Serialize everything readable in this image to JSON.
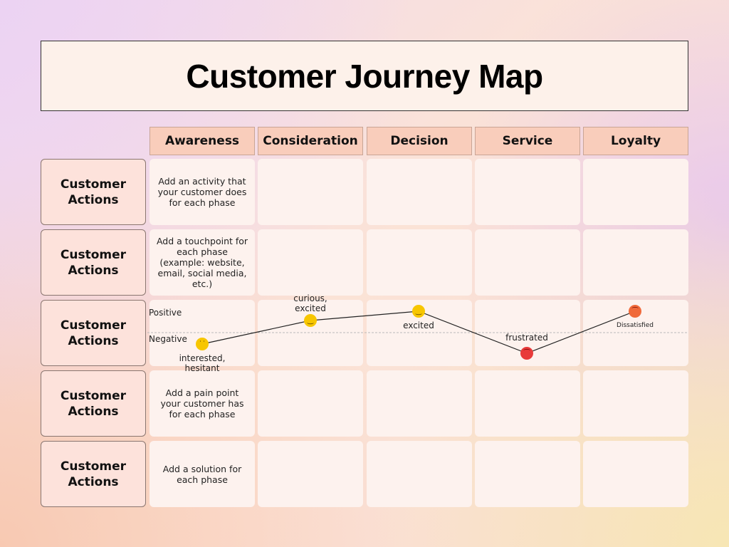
{
  "title": "Customer Journey Map",
  "phases": [
    "Awareness",
    "Consideration",
    "Decision",
    "Service",
    "Loyalty"
  ],
  "rows": [
    {
      "label": "Customer Actions",
      "awareness_text": "Add an activity that your customer does for each phase"
    },
    {
      "label": "Customer Actions",
      "awareness_text": "Add a touchpoint for each phase (example: website, email, social media, etc.)"
    },
    {
      "label": "Customer Actions",
      "awareness_text": ""
    },
    {
      "label": "Customer Actions",
      "awareness_text": "Add a pain point your customer has for each phase"
    },
    {
      "label": "Customer Actions",
      "awareness_text": "Add a solution for each phase"
    }
  ],
  "emotion": {
    "positive_label": "Positive",
    "negative_label": "Negative",
    "points": [
      {
        "phase": "Awareness",
        "label": "interested, hesitant",
        "sentiment": "negative",
        "icon": "confused-face-icon",
        "color": "#f7c600"
      },
      {
        "phase": "Consideration",
        "label": "curious, excited",
        "sentiment": "positive",
        "icon": "smiling-face-icon",
        "color": "#f7c600"
      },
      {
        "phase": "Decision",
        "label": "excited",
        "sentiment": "positive",
        "icon": "happy-face-icon",
        "color": "#f7c600"
      },
      {
        "phase": "Service",
        "label": "frustrated",
        "sentiment": "negative",
        "icon": "frowning-red-face-icon",
        "color": "#e83a3a"
      },
      {
        "phase": "Loyalty",
        "label": "Dissatisfied",
        "sentiment": "positive",
        "icon": "angry-face-icon",
        "color": "#f06a3a"
      }
    ]
  }
}
